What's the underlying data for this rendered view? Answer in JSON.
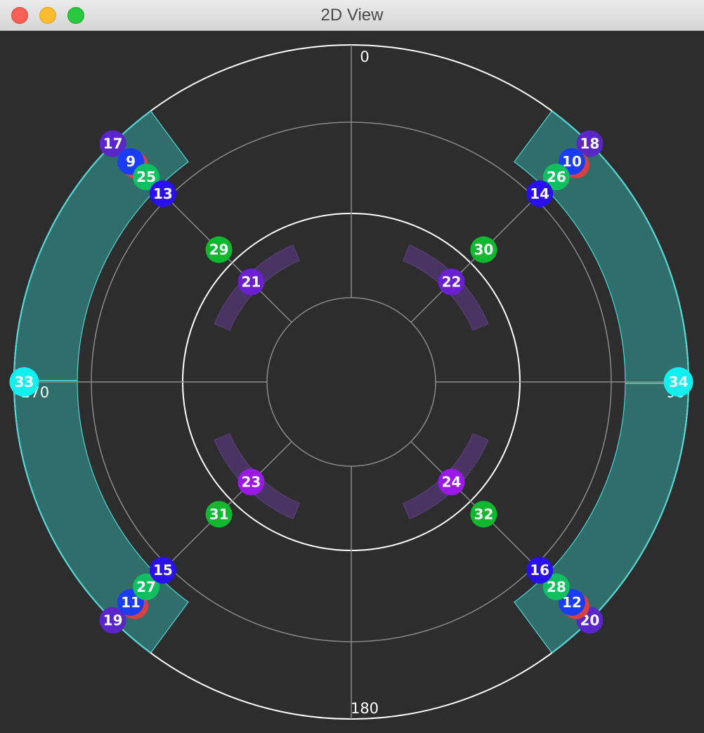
{
  "window": {
    "title": "2D View"
  },
  "axis_labels": {
    "top": "0",
    "right": "90",
    "bottom": "180",
    "left": "270"
  },
  "colors": {
    "background": "#2d2d2d",
    "grid": "#8a8a8a",
    "ring_white": "#ffffff",
    "zone_fill": "#2f6e6a",
    "zone_stroke": "#4fd6d6",
    "arc_purple": "#5a3a86",
    "red": "#d94040",
    "blue": "#1a3cff",
    "darkblue": "#2a10f0",
    "green": "#10c060",
    "brightgreen": "#10b830",
    "purple": "#6a1fd0",
    "violet": "#9a18e8",
    "indigo": "#5a26c8",
    "cyan": "#10f0f0"
  },
  "nodes": [
    {
      "label": "17",
      "angle": 315,
      "r": 1.0,
      "color": "indigo"
    },
    {
      "label": "9",
      "angle": 315,
      "r": 0.925,
      "color": "blue",
      "shadow": true
    },
    {
      "label": "25",
      "angle": 315,
      "r": 0.86,
      "color": "green"
    },
    {
      "label": "13",
      "angle": 315,
      "r": 0.79,
      "color": "darkblue"
    },
    {
      "label": "29",
      "angle": 315,
      "r": 0.555,
      "color": "brightgreen"
    },
    {
      "label": "21",
      "angle": 315,
      "r": 0.42,
      "color": "purple"
    },
    {
      "label": "18",
      "angle": 45,
      "r": 1.0,
      "color": "indigo"
    },
    {
      "label": "10",
      "angle": 45,
      "r": 0.925,
      "color": "blue",
      "shadow": true
    },
    {
      "label": "26",
      "angle": 45,
      "r": 0.86,
      "color": "green"
    },
    {
      "label": "14",
      "angle": 45,
      "r": 0.79,
      "color": "darkblue"
    },
    {
      "label": "30",
      "angle": 45,
      "r": 0.555,
      "color": "brightgreen"
    },
    {
      "label": "22",
      "angle": 45,
      "r": 0.42,
      "color": "purple"
    },
    {
      "label": "19",
      "angle": 225,
      "r": 1.0,
      "color": "indigo"
    },
    {
      "label": "11",
      "angle": 225,
      "r": 0.925,
      "color": "blue",
      "shadow": true
    },
    {
      "label": "27",
      "angle": 225,
      "r": 0.86,
      "color": "green"
    },
    {
      "label": "15",
      "angle": 225,
      "r": 0.79,
      "color": "darkblue"
    },
    {
      "label": "31",
      "angle": 225,
      "r": 0.555,
      "color": "brightgreen"
    },
    {
      "label": "23",
      "angle": 225,
      "r": 0.42,
      "color": "violet"
    },
    {
      "label": "20",
      "angle": 135,
      "r": 1.0,
      "color": "indigo"
    },
    {
      "label": "12",
      "angle": 135,
      "r": 0.925,
      "color": "blue",
      "shadow": true
    },
    {
      "label": "28",
      "angle": 135,
      "r": 0.86,
      "color": "green"
    },
    {
      "label": "16",
      "angle": 135,
      "r": 0.79,
      "color": "darkblue"
    },
    {
      "label": "32",
      "angle": 135,
      "r": 0.555,
      "color": "brightgreen"
    },
    {
      "label": "24",
      "angle": 135,
      "r": 0.42,
      "color": "violet"
    },
    {
      "label": "33",
      "angle": 270,
      "r": 0.97,
      "color": "cyan"
    },
    {
      "label": "34",
      "angle": 90,
      "r": 0.97,
      "color": "cyan"
    }
  ]
}
